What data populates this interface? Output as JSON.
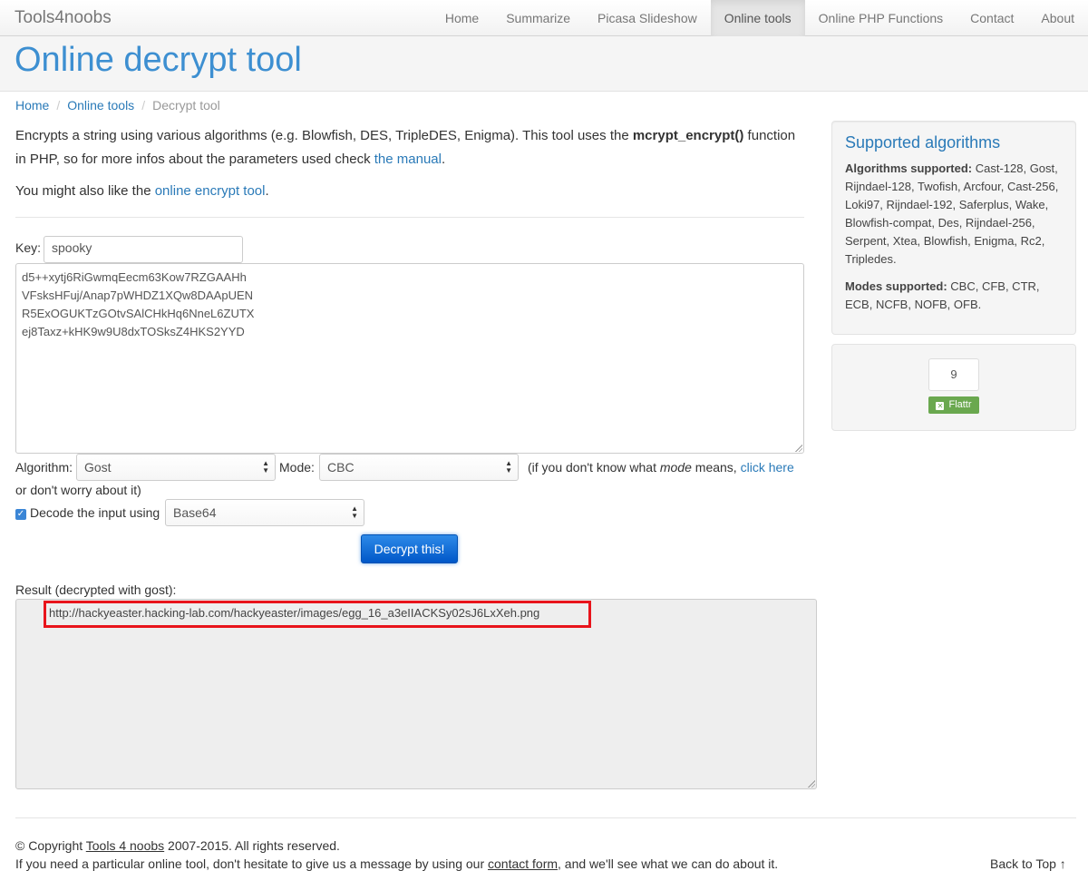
{
  "navbar": {
    "brand": "Tools4noobs",
    "items": [
      {
        "label": "Home"
      },
      {
        "label": "Summarize"
      },
      {
        "label": "Picasa Slideshow"
      },
      {
        "label": "Online tools"
      },
      {
        "label": "Online PHP Functions"
      },
      {
        "label": "Contact"
      },
      {
        "label": "About"
      }
    ],
    "active": "Online tools"
  },
  "page_title": "Online decrypt tool",
  "breadcrumb": {
    "items": [
      "Home",
      "Online tools",
      "Decrypt tool"
    ],
    "separator": "/"
  },
  "intro": {
    "p1_a": "Encrypts a string using various algorithms (e.g. Blowfish, DES, TripleDES, Enigma). This tool uses the ",
    "p1_bold": "mcrypt_encrypt()",
    "p1_b": " function in PHP, so for more infos about the parameters used check ",
    "p1_link": "the manual",
    "p1_c": ".",
    "p2_a": "You might also like the ",
    "p2_link": "online encrypt tool",
    "p2_b": "."
  },
  "form": {
    "key_label": "Key:",
    "key_value": "spooky",
    "cipher_lines": [
      "d5++xytj6RiGwmqEecm63Kow7RZGAAHh",
      "VFsksHFuj/Anap7pWHDZ1XQw8DAApUEN",
      "R5ExOGUKTzGOtvSAlCHkHq6NneL6ZUTX",
      "ej8Taxz+kHK9w9U8dxTOSksZ4HKS2YYD"
    ],
    "algorithm_label": "Algorithm:",
    "algorithm_value": "Gost",
    "mode_label": "Mode:",
    "mode_value": "CBC",
    "hint_a": "(if you don't know what ",
    "hint_em": "mode",
    "hint_b": " means, ",
    "hint_link": "click here",
    "hint_c": "or don't worry about it)",
    "decode_checked": true,
    "decode_label": "Decode the input using",
    "decode_value": "Base64",
    "submit_label": "Decrypt this!"
  },
  "result": {
    "label": "Result (decrypted with gost):",
    "text": "http://hackyeaster.hacking-lab.com/hackyeaster/images/egg_16_a3eIIACKSy02sJ6LxXeh.png",
    "highlight_color": "#e8141b"
  },
  "sidebar": {
    "title": "Supported algorithms",
    "algorithms_label": "Algorithms supported:",
    "algorithms": " Cast-128, Gost, Rijndael-128, Twofish, Arcfour, Cast-256, Loki97, Rijndael-192, Saferplus, Wake, Blowfish-compat, Des, Rijndael-256, Serpent, Xtea, Blowfish, Enigma, Rc2, Tripledes.",
    "modes_label": "Modes supported:",
    "modes": " CBC, CFB, CTR, ECB, NCFB, NOFB, OFB."
  },
  "flattr": {
    "count": "9",
    "label": "Flattr"
  },
  "footer": {
    "copyright_a": "© Copyright ",
    "copyright_link": "Tools 4 noobs",
    "copyright_b": " 2007-2015. All rights reserved.",
    "contact_a": "If you need a particular online tool, don't hesitate to give us a message by using our ",
    "contact_link": "contact form",
    "contact_b": ", and we'll see what we can do about it.",
    "back_to_top": "Back to Top",
    "back_to_top_icon": "↑"
  },
  "colors": {
    "accent": "#2a7ab8",
    "title": "#3d8fd1",
    "button": "#0057c8"
  }
}
